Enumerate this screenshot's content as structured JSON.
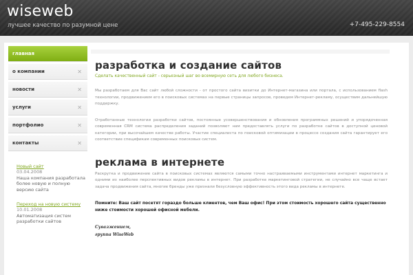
{
  "header": {
    "logo": "wiseweb",
    "tagline": "лучшее качество по разумной цене",
    "phone": "+7-495-229-8554"
  },
  "sidebar": {
    "items": [
      {
        "label": "главная",
        "active": true
      },
      {
        "label": "о компании"
      },
      {
        "label": "новости"
      },
      {
        "label": "услуги"
      },
      {
        "label": "портфолио"
      },
      {
        "label": "контакты"
      }
    ]
  },
  "news": [
    {
      "title": "Новый сайт",
      "date": "03.04.2008",
      "text": "Наша компания разработала более новую и полную версию сайта"
    },
    {
      "title": "Переход на новую систему",
      "date": "10.01.2008",
      "text": "Автоматизация систем разработки сайтов"
    }
  ],
  "main": {
    "section1": {
      "title": "разработка и создание сайтов",
      "subtitle": "Сделать качественный сайт - серьезный шаг во всемирную сеть для любого бизнеса.",
      "p1": "Мы разработаем для Вас сайт любой сложности - от простого сайта визитки до Интернет-магазина или портала, с использованием flash технологии, продвижением его в поисковых системах на первые страницы запросов, проведем Интернет-рекламу, осуществим дальнейшую поддержку.",
      "p2": "Отработанные технологии разработки сайтов, постоянные усовершенствования и обновления программных решений и упорядоченная современная CRM система распределения заданий позволяют нам предоставлять услуги по разработке сайтов в доступной ценовой категории, при высочайшем качестве работы. Участие специалиста по поисковой оптимизации в процессе создания сайта гарантирует его соответствие спецификам современных поисковых систем."
    },
    "section2": {
      "title": "реклама в интернете",
      "p1": "Раскрутка и продвижение сайта в поисковых системах являются самыми точно настраиваемыми инструментами интернет маркетинга и одними из наиболее перспективных видов рекламы в интернет. При разработке маркетинговой стратегии, не случайно все чаще встает задача продвижения сайта, многие бренды уже признали безусловную эффективность этого вида рекламы в интернете.",
      "bold": "Помните: Ваш сайт посетят гораздо больше клиентов, чем Ваш офис! При этом стоимость хорошего сайта существенно ниже стоимости хорошей офисной мебели.",
      "sign1": "Сувазжением,",
      "sign2": "группа WiseWeb"
    }
  }
}
